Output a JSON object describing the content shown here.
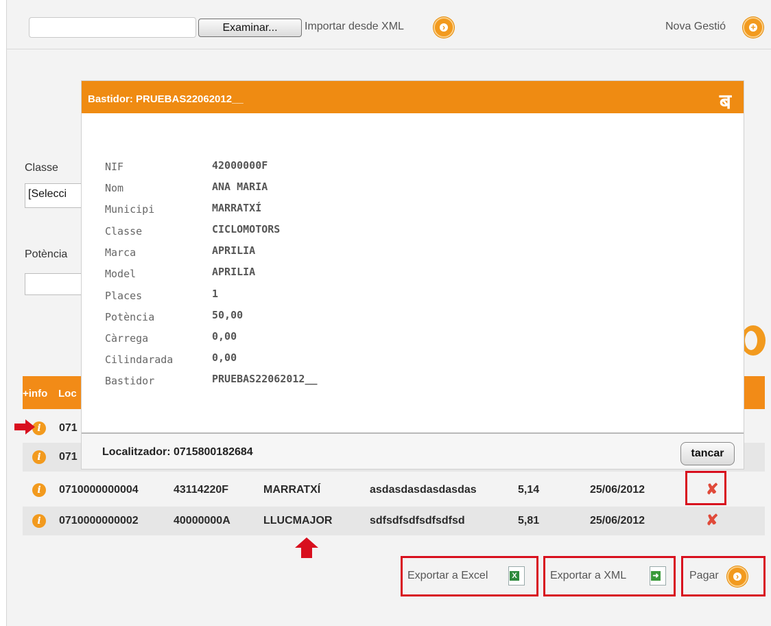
{
  "toolbar": {
    "browse_label": "Examinar...",
    "import_label": "Importar desde XML",
    "new_label": "Nova Gestió"
  },
  "filters": {
    "classe_label": "Classe",
    "classe_value": "[Selecci",
    "potencia_label": "Potència"
  },
  "table": {
    "header_info": "+info",
    "header_loc": "Loc",
    "rows": [
      {
        "loc": "071",
        "nif": "",
        "municipi": "",
        "cognom": "",
        "potencia": "",
        "data": ""
      },
      {
        "loc": "071",
        "nif": "",
        "municipi": "",
        "cognom": "",
        "potencia": "",
        "data": ""
      },
      {
        "loc": "0710000000004",
        "nif": "43114220F",
        "municipi": "MARRATXÍ",
        "cognom": "asdasdasdasdasdas",
        "potencia": "5,14",
        "data": "25/06/2012"
      },
      {
        "loc": "0710000000002",
        "nif": "40000000A",
        "municipi": "LLUCMAJOR",
        "cognom": "sdfsdfsdfsdfsdfsd",
        "potencia": "5,81",
        "data": "25/06/2012"
      }
    ]
  },
  "actions": {
    "export_excel": "Exportar a Excel",
    "export_xml": "Exportar a XML",
    "pay": "Pagar"
  },
  "modal": {
    "title": "Bastidor: PRUEBAS22062012__",
    "logo": "ब",
    "fields": [
      {
        "label": "NIF",
        "value": "42000000F"
      },
      {
        "label": "Nom",
        "value": "ANA MARIA"
      },
      {
        "label": "Municipi",
        "value": "MARRATXÍ"
      },
      {
        "label": "Classe",
        "value": "CICLOMOTORS"
      },
      {
        "label": "Marca",
        "value": "APRILIA"
      },
      {
        "label": "Model",
        "value": "APRILIA"
      },
      {
        "label": "Places",
        "value": "1"
      },
      {
        "label": "Potència",
        "value": "50,00"
      },
      {
        "label": "Càrrega",
        "value": "0,00"
      },
      {
        "label": "Cilindarada",
        "value": "0,00"
      },
      {
        "label": "Bastidor",
        "value": "PRUEBAS22062012__"
      }
    ],
    "localitzador": "Localitzador: 0715800182684",
    "close_label": "tancar"
  },
  "colors": {
    "accent": "#f28b17",
    "highlight_frame": "#d80f1e",
    "delete": "#e04a3a"
  }
}
